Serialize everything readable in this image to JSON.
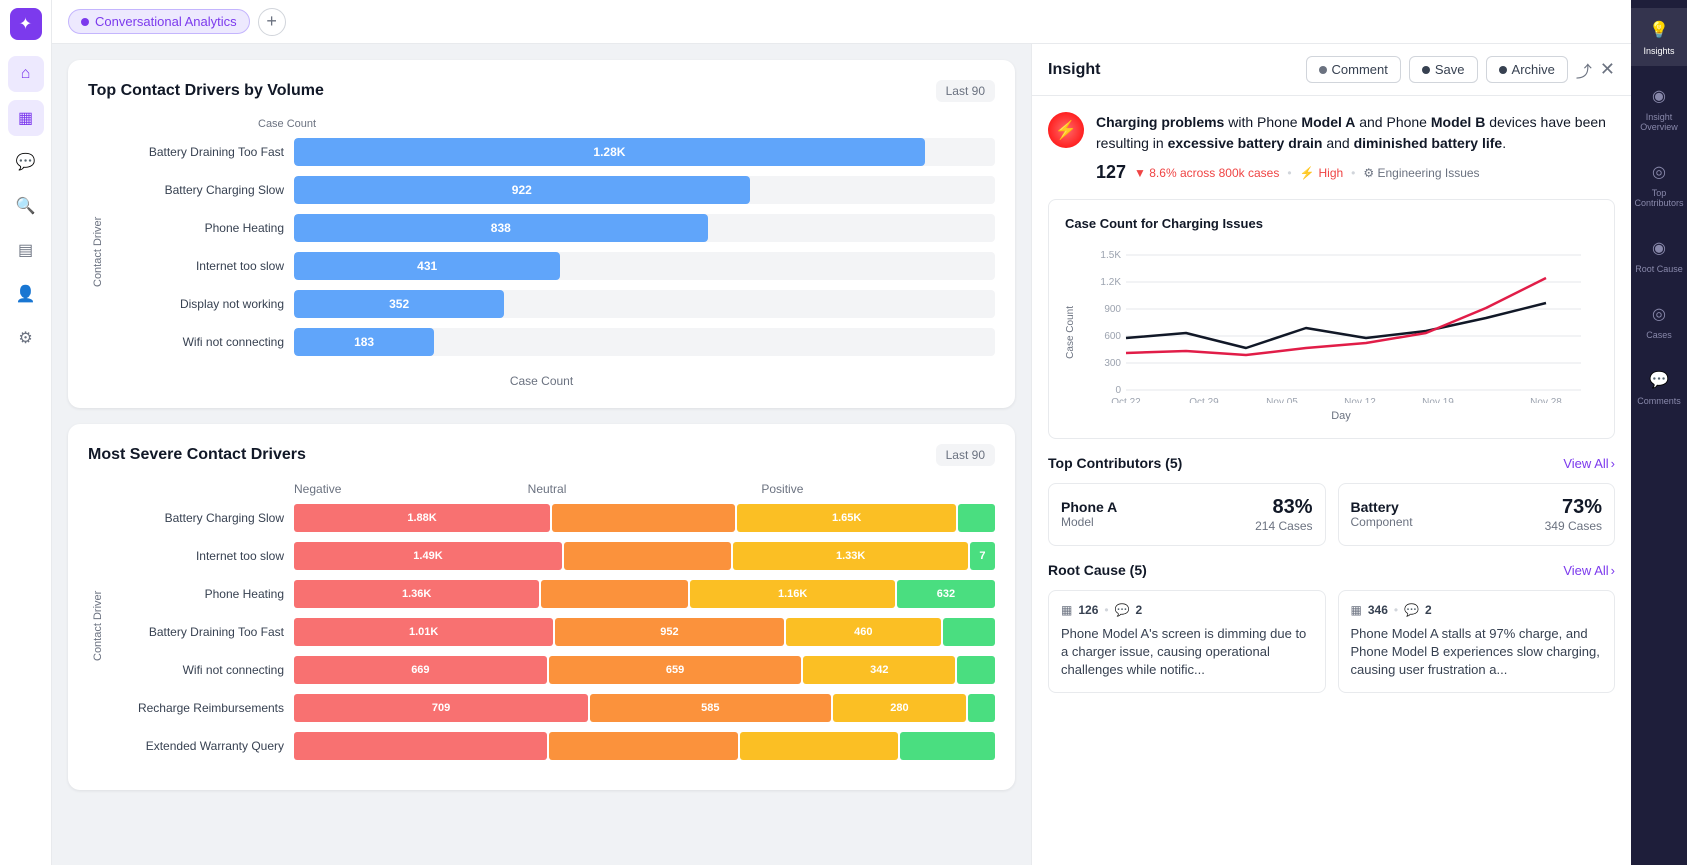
{
  "app": {
    "logo": "✦",
    "tab_label": "Conversational Analytics",
    "add_tab_icon": "+"
  },
  "left_nav": {
    "items": [
      {
        "id": "home",
        "icon": "⌂",
        "active": false
      },
      {
        "id": "bar-chart",
        "icon": "▦",
        "active": true
      },
      {
        "id": "chat",
        "icon": "💬",
        "active": false
      },
      {
        "id": "search",
        "icon": "🔍",
        "active": false
      },
      {
        "id": "message-square",
        "icon": "▤",
        "active": false
      },
      {
        "id": "user",
        "icon": "👤",
        "active": false
      },
      {
        "id": "settings",
        "icon": "⚙",
        "active": false
      }
    ]
  },
  "top_chart": {
    "title": "Top Contact Drivers by Volume",
    "badge": "Last 90",
    "y_label": "Contact Driver",
    "x_label": "Case Count",
    "bars": [
      {
        "label": "Battery Draining Too Fast",
        "value": "1.28K",
        "pct": 90
      },
      {
        "label": "Battery Charging Slow",
        "value": "922",
        "pct": 65
      },
      {
        "label": "Phone Heating",
        "value": "838",
        "pct": 59
      },
      {
        "label": "Internet too slow",
        "value": "431",
        "pct": 38
      },
      {
        "label": "Display not working",
        "value": "352",
        "pct": 30
      },
      {
        "label": "Wifi not connecting",
        "value": "183",
        "pct": 20
      }
    ]
  },
  "bottom_chart": {
    "title": "Most Severe Contact Drivers",
    "badge": "Last 90",
    "y_label": "Contact Driver",
    "columns": [
      "Negative",
      "Neutral",
      "Positive"
    ],
    "bars": [
      {
        "label": "Battery Charging Slow",
        "segs": [
          {
            "val": "1.88K",
            "pct": 35,
            "cls": "seg-red"
          },
          {
            "val": "",
            "pct": 25,
            "cls": "seg-orange"
          },
          {
            "val": "1.65K",
            "pct": 30,
            "cls": "seg-yellow"
          },
          {
            "val": "",
            "pct": 5,
            "cls": "seg-green"
          }
        ]
      },
      {
        "label": "Internet too slow",
        "segs": [
          {
            "val": "1.49K",
            "pct": 32,
            "cls": "seg-red"
          },
          {
            "val": "",
            "pct": 20,
            "cls": "seg-orange"
          },
          {
            "val": "1.33K",
            "pct": 28,
            "cls": "seg-yellow"
          },
          {
            "val": "7",
            "pct": 3,
            "cls": "seg-green"
          }
        ]
      },
      {
        "label": "Phone Heating",
        "segs": [
          {
            "val": "1.36K",
            "pct": 30,
            "cls": "seg-red"
          },
          {
            "val": "",
            "pct": 18,
            "cls": "seg-orange"
          },
          {
            "val": "1.16K",
            "pct": 25,
            "cls": "seg-yellow"
          },
          {
            "val": "632",
            "pct": 12,
            "cls": "seg-green"
          }
        ]
      },
      {
        "label": "Battery Draining Too Fast",
        "segs": [
          {
            "val": "1.01K",
            "pct": 25,
            "cls": "seg-red"
          },
          {
            "val": "952",
            "pct": 22,
            "cls": "seg-orange"
          },
          {
            "val": "460",
            "pct": 15,
            "cls": "seg-yellow"
          },
          {
            "val": "",
            "pct": 5,
            "cls": "seg-green"
          }
        ]
      },
      {
        "label": "Wifi not connecting",
        "segs": [
          {
            "val": "669",
            "pct": 20,
            "cls": "seg-red"
          },
          {
            "val": "659",
            "pct": 20,
            "cls": "seg-orange"
          },
          {
            "val": "342",
            "pct": 12,
            "cls": "seg-yellow"
          },
          {
            "val": "",
            "pct": 3,
            "cls": "seg-green"
          }
        ]
      },
      {
        "label": "Recharge Reimbursements",
        "segs": [
          {
            "val": "709",
            "pct": 22,
            "cls": "seg-red"
          },
          {
            "val": "585",
            "pct": 18,
            "cls": "seg-orange"
          },
          {
            "val": "280",
            "pct": 10,
            "cls": "seg-yellow"
          },
          {
            "val": "",
            "pct": 2,
            "cls": "seg-green"
          }
        ]
      },
      {
        "label": "Extended Warranty Query",
        "segs": [
          {
            "val": "",
            "pct": 8,
            "cls": "seg-red"
          },
          {
            "val": "",
            "pct": 6,
            "cls": "seg-orange"
          },
          {
            "val": "",
            "pct": 5,
            "cls": "seg-yellow"
          },
          {
            "val": "",
            "pct": 3,
            "cls": "seg-green"
          }
        ]
      }
    ]
  },
  "insight_panel": {
    "title": "Insight",
    "buttons": {
      "comment": "Comment",
      "save": "Save",
      "archive": "Archive"
    },
    "description_parts": [
      "Charging problems",
      " with Phone ",
      "Model A",
      " and Phone ",
      "Model B",
      " devices have been resulting in ",
      "excessive battery drain",
      " and ",
      "diminished battery life",
      "."
    ],
    "description_bold": [
      "Charging problems",
      "Model A",
      "Model B",
      "excessive battery drain",
      "diminished battery life"
    ],
    "description_text": "Charging problems with Phone Model A and Phone Model B devices have been resulting in excessive battery drain and diminished battery life.",
    "count": "127",
    "meta": {
      "change": "▼ 8.6% across 800k cases",
      "priority": "High",
      "category": "Engineering Issues"
    },
    "case_count_chart": {
      "title": "Case Count for Charging Issues",
      "y_label": "Case Count",
      "x_label": "Day",
      "y_ticks": [
        "1.5K",
        "1.2K",
        "900",
        "600",
        "300",
        "0"
      ],
      "x_ticks": [
        "Oct 22",
        "Oct 29",
        "Nov 05",
        "Nov 12",
        "Nov 19",
        "Nov 28"
      ]
    },
    "top_contributors": {
      "title": "Top Contributors (5)",
      "view_all": "View All",
      "items": [
        {
          "name": "Phone A",
          "type": "Model",
          "pct": "83%",
          "cases": "214 Cases"
        },
        {
          "name": "Battery",
          "type": "Component",
          "pct": "73%",
          "cases": "349 Cases"
        }
      ]
    },
    "root_cause": {
      "title": "Root Cause (5)",
      "view_all": "View All",
      "items": [
        {
          "count1": "126",
          "count2": "2",
          "text": "Phone Model A's screen is dimming due to a charger issue, causing operational challenges while notific..."
        },
        {
          "count1": "346",
          "count2": "2",
          "text": "Phone Model A stalls at 97% charge, and Phone Model B experiences slow charging, causing user frustration a..."
        }
      ]
    }
  },
  "right_sidebar": {
    "items": [
      {
        "id": "insights",
        "icon": "💡",
        "label": "Insights",
        "active": true
      },
      {
        "id": "insight-overview",
        "icon": "◉",
        "label": "Insight Overview",
        "active": false
      },
      {
        "id": "top-contributors",
        "icon": "◎",
        "label": "Top Contributors",
        "active": false
      },
      {
        "id": "root-cause",
        "icon": "◉",
        "label": "Root Cause",
        "active": false
      },
      {
        "id": "cases",
        "icon": "◎",
        "label": "Cases",
        "active": false
      },
      {
        "id": "comments",
        "icon": "💬",
        "label": "Comments",
        "active": false
      }
    ]
  }
}
